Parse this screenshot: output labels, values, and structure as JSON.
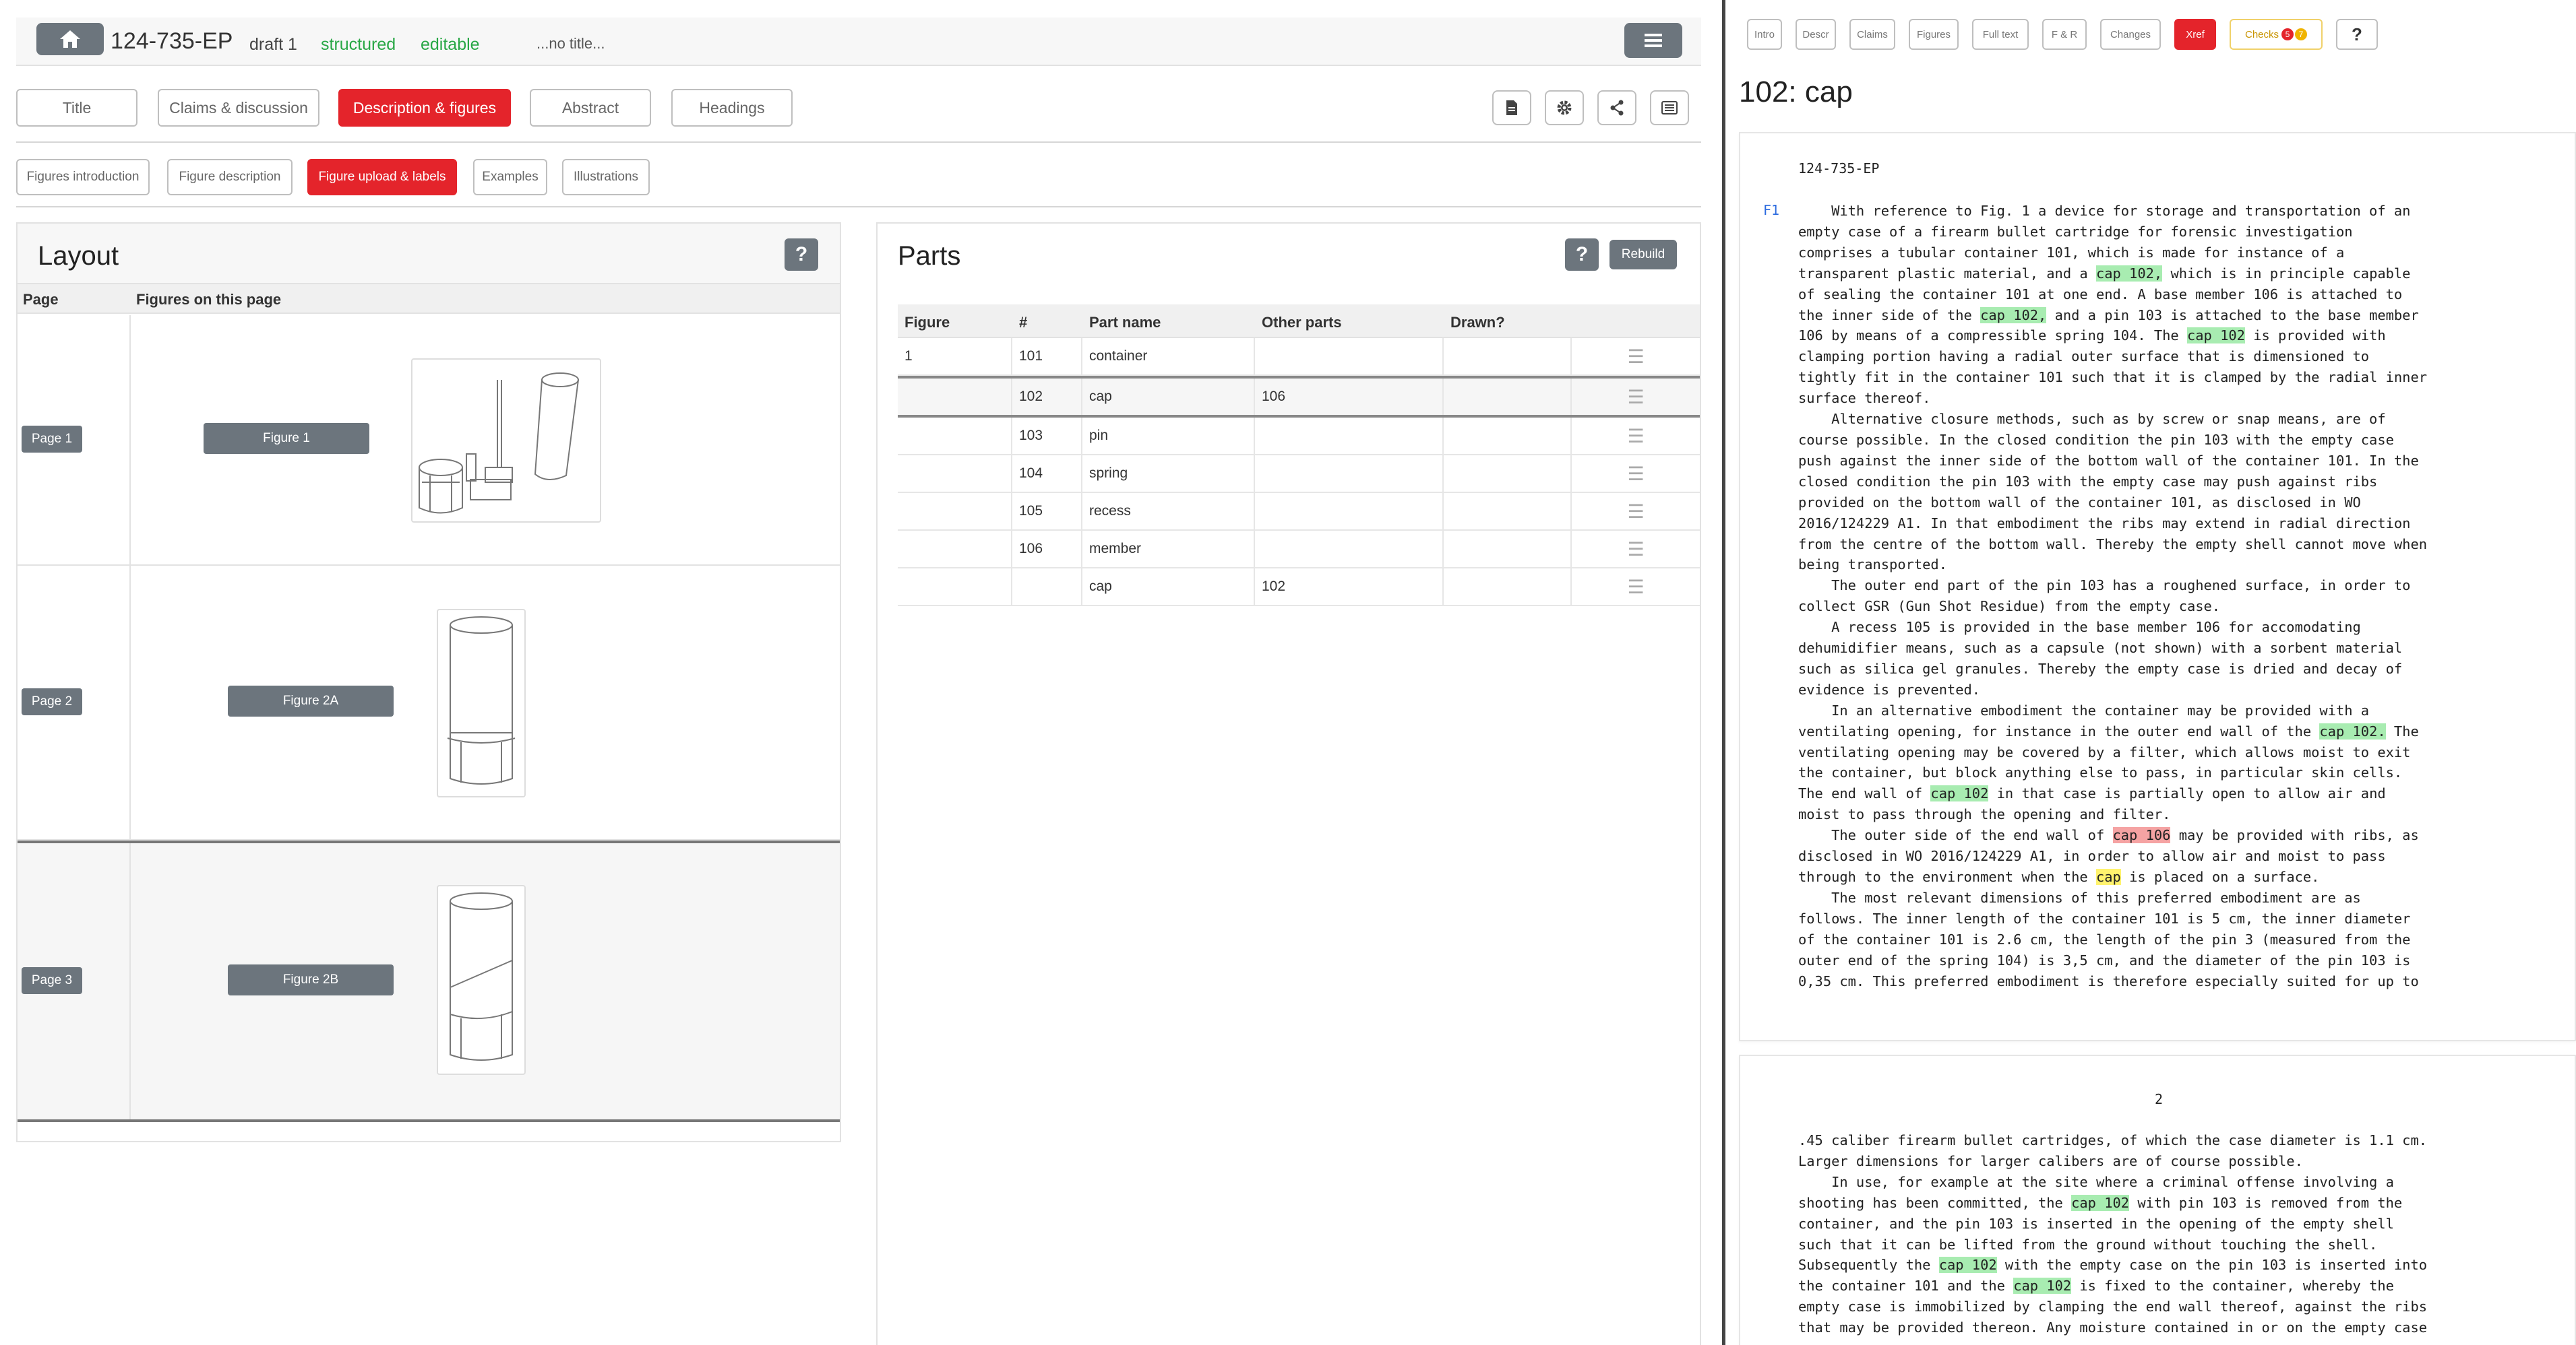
{
  "header": {
    "app_id": "124-735-EP",
    "draft": "draft 1",
    "structured": "structured",
    "editable": "editable",
    "title_placeholder": "...no title...",
    "home_icon": "home-icon",
    "menu_icon": "hamburger-icon"
  },
  "tabs": {
    "primary": [
      "Title",
      "Claims & discussion",
      "Description & figures",
      "Abstract",
      "Headings"
    ],
    "primary_active": "Description & figures",
    "secondary": [
      "Figures introduction",
      "Figure description",
      "Figure upload & labels",
      "Examples",
      "Illustrations"
    ],
    "secondary_active": "Figure upload & labels",
    "icon_buttons": [
      "document-icon",
      "gear-icon",
      "share-icon",
      "list-icon"
    ]
  },
  "layout_panel": {
    "title": "Layout",
    "help": "?",
    "col_page": "Page",
    "col_figures": "Figures on this page",
    "rows": [
      {
        "page": "Page 1",
        "figure": "Figure 1"
      },
      {
        "page": "Page 2",
        "figure": "Figure 2A"
      },
      {
        "page": "Page 3",
        "figure": "Figure 2B"
      }
    ]
  },
  "parts_panel": {
    "title": "Parts",
    "help": "?",
    "rebuild": "Rebuild",
    "columns": [
      "Figure",
      "#",
      "Part name",
      "Other parts",
      "Drawn?"
    ],
    "rows": [
      {
        "figure": "1",
        "num": "101",
        "name": "container",
        "other": "",
        "drawn": ""
      },
      {
        "figure": "",
        "num": "102",
        "name": "cap",
        "other": "106",
        "drawn": ""
      },
      {
        "figure": "",
        "num": "103",
        "name": "pin",
        "other": "",
        "drawn": ""
      },
      {
        "figure": "",
        "num": "104",
        "name": "spring",
        "other": "",
        "drawn": ""
      },
      {
        "figure": "",
        "num": "105",
        "name": "recess",
        "other": "",
        "drawn": ""
      },
      {
        "figure": "",
        "num": "106",
        "name": "member",
        "other": "",
        "drawn": ""
      },
      {
        "figure": "",
        "num": "",
        "name": "cap",
        "other": "102",
        "drawn": ""
      }
    ],
    "drag_icon": "drag-handle-icon"
  },
  "right_tabs": {
    "items": [
      "Intro",
      "Descr",
      "Claims",
      "Figures",
      "Full text",
      "F & R",
      "Changes",
      "Xref",
      "Checks",
      "?"
    ],
    "active": "Xref",
    "checks_red": "5",
    "checks_yellow": "7"
  },
  "xref": {
    "title": "102: cap",
    "doc_id": "124-735-EP",
    "paragraph_label": "F1",
    "page2_number": "2"
  },
  "colors": {
    "accent_red": "#e4242b",
    "dark_button": "#6c757d",
    "ok_green": "#28a745",
    "highlight_green": "#a8ecb1",
    "highlight_red": "#f5a3a3",
    "highlight_yellow": "#fff36e"
  }
}
